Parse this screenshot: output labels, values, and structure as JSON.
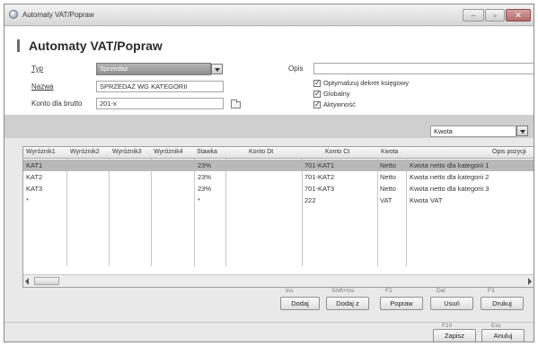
{
  "window": {
    "title": "Automaty VAT/Popraw"
  },
  "header": {
    "title": "Automaty VAT/Popraw"
  },
  "form": {
    "typ_label": "Typ",
    "typ_value": "Sprzedaż",
    "nazwa_label": "Nazwa",
    "nazwa_value": "SPRZEDAŻ WG KATEGORII",
    "konto_label": "Konto dla brutto",
    "konto_value": "201-x",
    "opis_label": "Opis",
    "opis_value": "",
    "checkboxes": [
      {
        "label": "Optymalizuj dekret księgowy",
        "checked": true
      },
      {
        "label": "Globalny",
        "checked": true
      },
      {
        "label": "Aktywność",
        "checked": true
      }
    ]
  },
  "filter": {
    "kwota_value": "Kwota"
  },
  "table": {
    "columns": [
      "Wyróżnik1",
      "Wyróżnik2",
      "Wyróżnik3",
      "Wyróżnik4",
      "Stawka",
      "Konto Dt",
      "Konto Ct",
      "Kwota",
      "Opis pozycji"
    ],
    "rows": [
      {
        "w1": "KAT1",
        "stawka": "23%",
        "kontoCt": "701-KAT1",
        "kwota": "Netto",
        "opis": "Kwota netto dla kategorii 1",
        "selected": true
      },
      {
        "w1": "KAT2",
        "stawka": "23%",
        "kontoCt": "701-KAT2",
        "kwota": "Netto",
        "opis": "Kwota netto dla kategorii 2",
        "selected": false
      },
      {
        "w1": "KAT3",
        "stawka": "23%",
        "kontoCt": "701-KAT3",
        "kwota": "Netto",
        "opis": "Kwota netto dla kategorii 3",
        "selected": false
      },
      {
        "w1": "*",
        "stawka": "*",
        "kontoCt": "222",
        "kwota": "VAT",
        "opis": "Kwota VAT",
        "selected": false
      }
    ]
  },
  "toolbar": {
    "dodaj": {
      "label": "Dodaj",
      "key": "Ins"
    },
    "dodaj_z": {
      "label": "Dodaj z",
      "key": "Shift+Ins"
    },
    "popraw": {
      "label": "Popraw",
      "key": "F2"
    },
    "usun": {
      "label": "Usuń",
      "key": "Del"
    },
    "drukuj": {
      "label": "Drukuj",
      "key": "F3"
    }
  },
  "footer": {
    "zapisz": {
      "label": "Zapisz",
      "key": "F10"
    },
    "anuluj": {
      "label": "Anuluj",
      "key": "Esc"
    }
  }
}
